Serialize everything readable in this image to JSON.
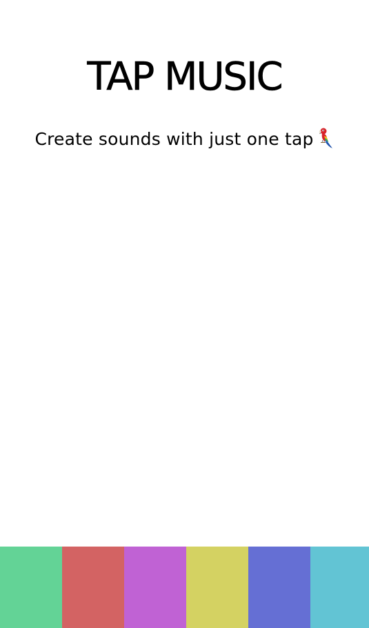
{
  "header": {
    "title": "TAP MUSIC",
    "subtitle": "Create sounds with just one tap"
  },
  "icons": {
    "subtitle_icon": "parrot-icon"
  },
  "pads": [
    {
      "name": "pad-1",
      "color": "#63d396"
    },
    {
      "name": "pad-2",
      "color": "#d36363"
    },
    {
      "name": "pad-3",
      "color": "#c062d4"
    },
    {
      "name": "pad-4",
      "color": "#d4d262"
    },
    {
      "name": "pad-5",
      "color": "#656fd4"
    },
    {
      "name": "pad-6",
      "color": "#62c4d4"
    }
  ]
}
